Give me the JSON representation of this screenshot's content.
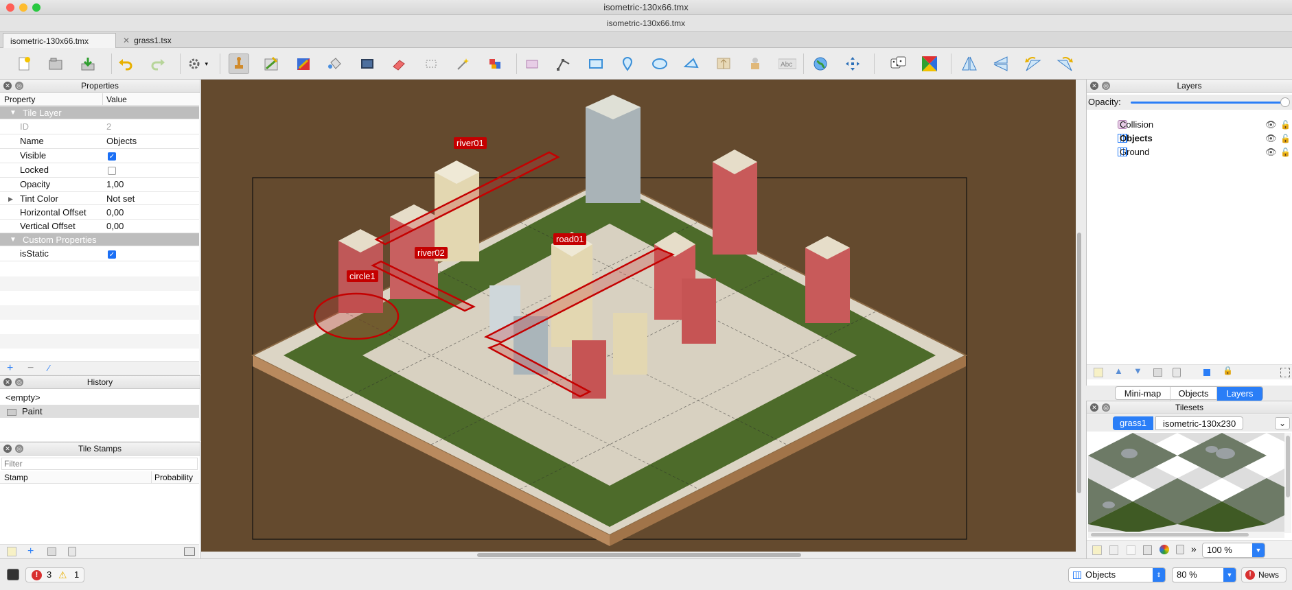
{
  "window": {
    "title": "isometric-130x66.tmx",
    "document_title": "isometric-130x66.tmx"
  },
  "tabs": [
    {
      "label": "isometric-130x66.tmx"
    },
    {
      "label": "grass1.tsx"
    }
  ],
  "properties": {
    "title": "Properties",
    "header": {
      "property": "Property",
      "value": "Value"
    },
    "group_tile_layer": "Tile Layer",
    "rows": [
      {
        "key": "ID",
        "value": "2"
      },
      {
        "key": "Name",
        "value": "Objects"
      },
      {
        "key": "Visible",
        "value": "checked"
      },
      {
        "key": "Locked",
        "value": "unchecked"
      },
      {
        "key": "Opacity",
        "value": "1,00"
      },
      {
        "key": "Tint Color",
        "value": "Not set"
      },
      {
        "key": "Horizontal Offset",
        "value": "0,00"
      },
      {
        "key": "Vertical Offset",
        "value": "0,00"
      }
    ],
    "group_custom": "Custom Properties",
    "custom_rows": [
      {
        "key": "isStatic",
        "value": "checked"
      }
    ]
  },
  "history": {
    "title": "History",
    "items": [
      "<empty>",
      "Paint"
    ]
  },
  "tile_stamps": {
    "title": "Tile Stamps",
    "filter_placeholder": "Filter",
    "col_stamp": "Stamp",
    "col_probability": "Probability"
  },
  "canvas": {
    "labels": [
      "river01",
      "river02",
      "road01",
      "circle1"
    ],
    "zoom": "80 %"
  },
  "layers": {
    "title": "Layers",
    "opacity_label": "Opacity:",
    "opacity_value": 1.0,
    "items": [
      {
        "name": "Collision",
        "type": "object",
        "visible": true
      },
      {
        "name": "Objects",
        "type": "tile",
        "visible": true,
        "bold": true
      },
      {
        "name": "Ground",
        "type": "tile",
        "visible": true
      }
    ]
  },
  "bottom_tabs": [
    "Mini-map",
    "Objects",
    "Layers"
  ],
  "tilesets": {
    "title": "Tilesets",
    "tabs": [
      "grass1",
      "isometric-130x230"
    ],
    "zoom": "100 %"
  },
  "status": {
    "errors": "3",
    "warnings": "1",
    "layer_combo": "Objects",
    "zoom_combo": "80 %",
    "news": "News"
  },
  "colors": {
    "accent": "#1b6ff5",
    "label_red": "#c40000",
    "canvas_bg": "#644a2e",
    "grass": "#4d6b2a"
  }
}
